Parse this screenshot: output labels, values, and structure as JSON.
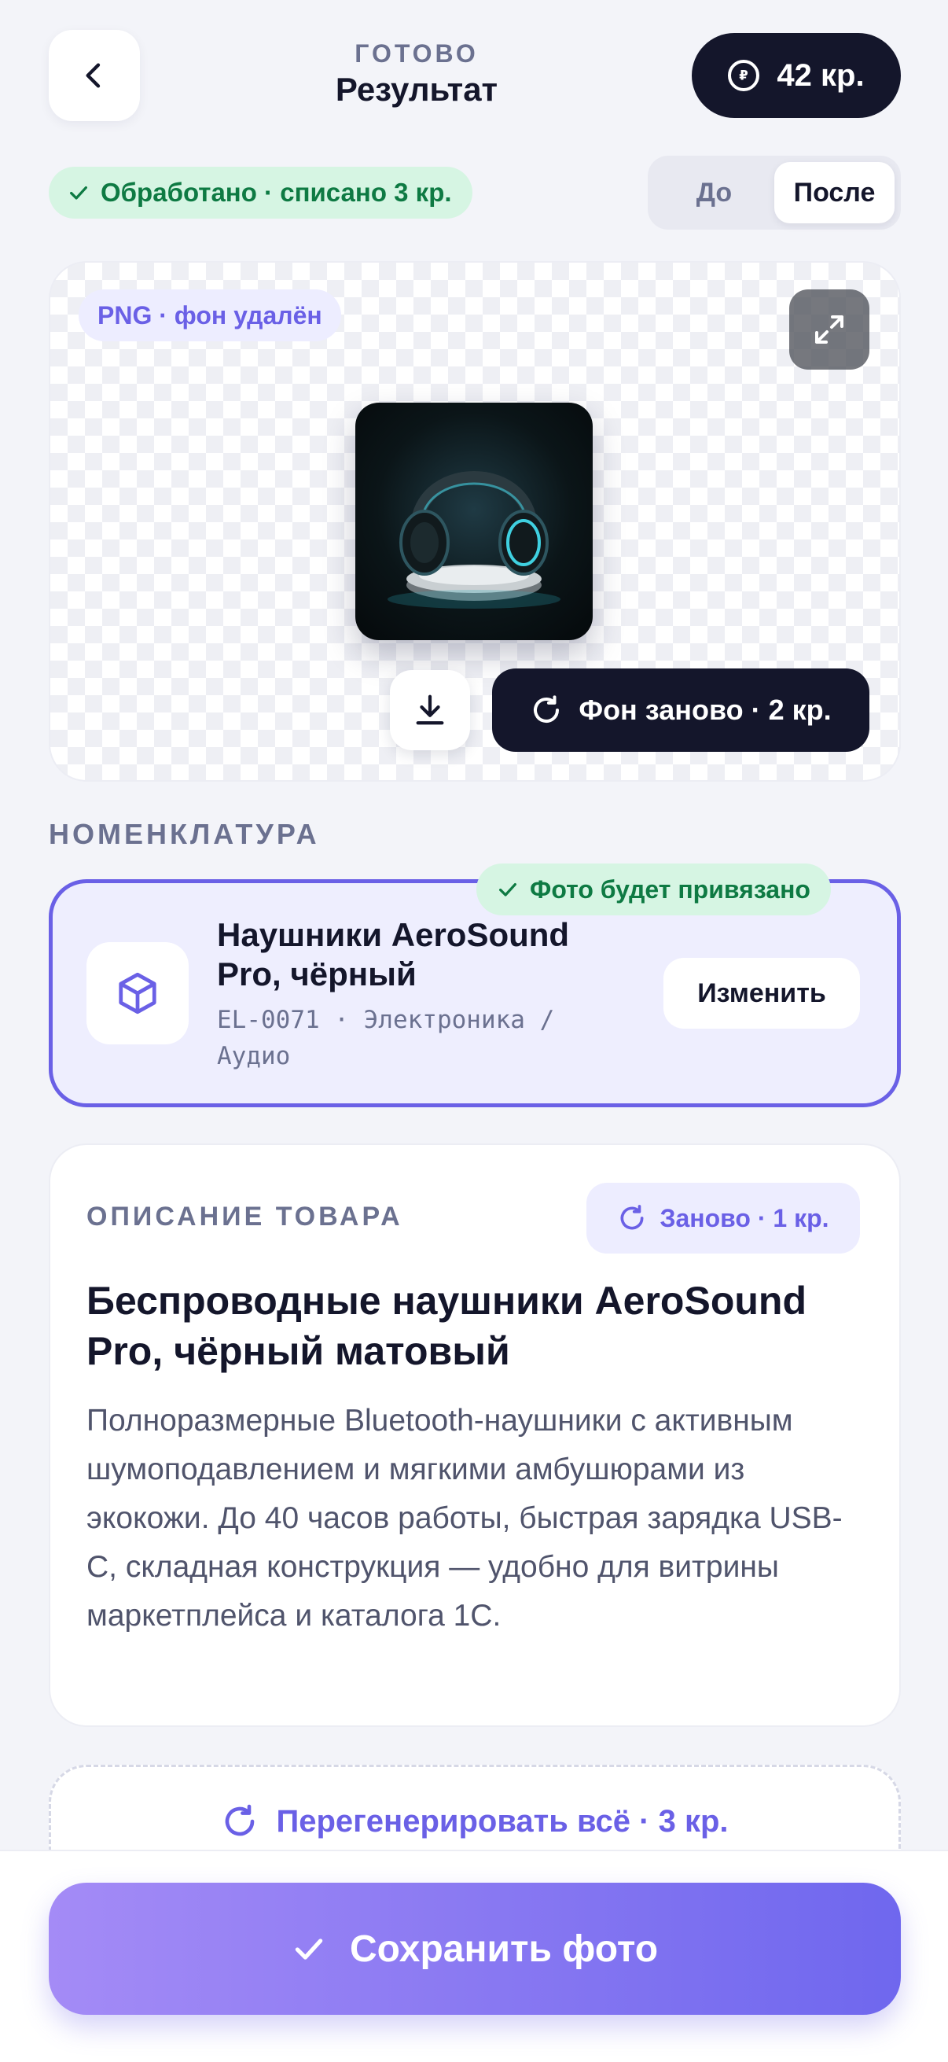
{
  "header": {
    "status_caption": "ГОТОВО",
    "title": "Результат",
    "credits": "42 кр."
  },
  "status": {
    "processed": "Обработано · списано 3 кр."
  },
  "view_toggle": {
    "before": "До",
    "after": "После",
    "selected": "После"
  },
  "preview": {
    "format_badge": "PNG · фон удалён",
    "regen_background": "Фон заново · 2 кр."
  },
  "nomenclature": {
    "section_label": "НОМЕНКЛАТУРА",
    "linked_badge": "Фото будет привязано",
    "product_name": "Наушники AeroSound Pro, чёрный",
    "sku_line": "EL-0071 · Электроника / Аудио",
    "change_button": "Изменить"
  },
  "description": {
    "section_label": "ОПИСАНИЕ ТОВАРА",
    "regen_button": "Заново · 1 кр.",
    "title": "Беспроводные наушники AeroSound Pro, чёрный матовый",
    "body": "Полноразмерные Bluetooth-наушники с активным шумоподавлением и мягкими амбушюрами из экокожи. До 40 часов работы, быстрая зарядка USB-C, складная конструкция — удобно для витрины маркетплейса и каталога 1С."
  },
  "regenerate_all": {
    "label": "Перегенерировать всё · 3 кр."
  },
  "footer": {
    "save_button": "Сохранить фото"
  },
  "colors": {
    "accent": "#6A60E6",
    "dark": "#14162B",
    "success_bg": "#D6F5E3",
    "success_text": "#0E7A43",
    "background": "#F3F4F9"
  }
}
